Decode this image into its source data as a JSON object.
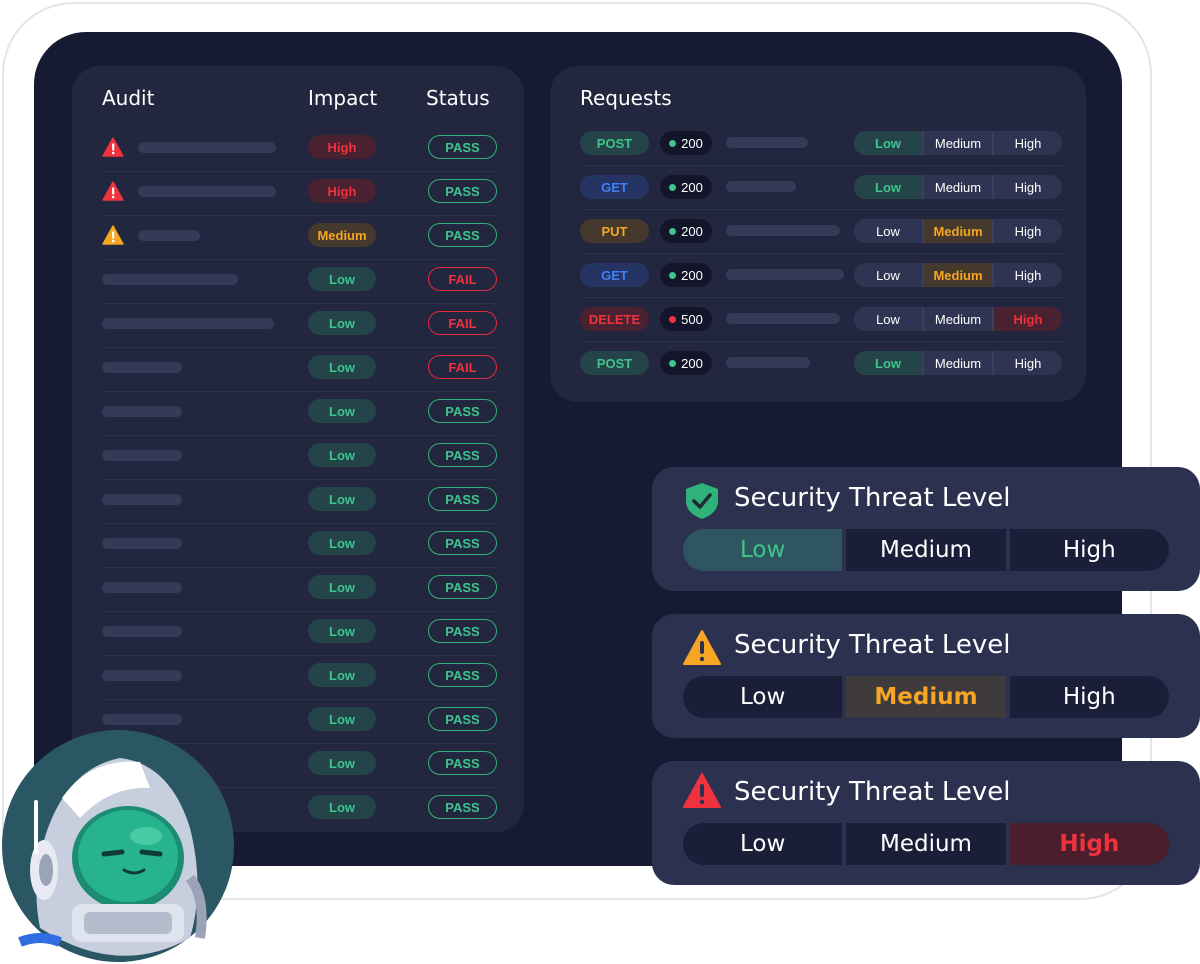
{
  "audit": {
    "header_audit": "Audit",
    "header_impact": "Impact",
    "header_status": "Status",
    "rows": [
      {
        "warn": "red",
        "bar": 138,
        "impact": "High",
        "status": "PASS"
      },
      {
        "warn": "red",
        "bar": 138,
        "impact": "High",
        "status": "PASS"
      },
      {
        "warn": "orange",
        "bar": 62,
        "impact": "Medium",
        "status": "PASS"
      },
      {
        "warn": "none",
        "bar": 136,
        "impact": "Low",
        "status": "FAIL"
      },
      {
        "warn": "none",
        "bar": 172,
        "impact": "Low",
        "status": "FAIL"
      },
      {
        "warn": "none",
        "bar": 80,
        "impact": "Low",
        "status": "FAIL"
      },
      {
        "warn": "none",
        "bar": 80,
        "impact": "Low",
        "status": "PASS"
      },
      {
        "warn": "none",
        "bar": 80,
        "impact": "Low",
        "status": "PASS"
      },
      {
        "warn": "none",
        "bar": 80,
        "impact": "Low",
        "status": "PASS"
      },
      {
        "warn": "none",
        "bar": 80,
        "impact": "Low",
        "status": "PASS"
      },
      {
        "warn": "none",
        "bar": 80,
        "impact": "Low",
        "status": "PASS"
      },
      {
        "warn": "none",
        "bar": 80,
        "impact": "Low",
        "status": "PASS"
      },
      {
        "warn": "none",
        "bar": 80,
        "impact": "Low",
        "status": "PASS"
      },
      {
        "warn": "none",
        "bar": 80,
        "impact": "Low",
        "status": "PASS"
      },
      {
        "warn": "none",
        "bar": 80,
        "impact": "Low",
        "status": "PASS"
      },
      {
        "warn": "none",
        "bar": 80,
        "impact": "Low",
        "status": "PASS"
      }
    ]
  },
  "requests": {
    "header": "Requests",
    "levels": [
      "Low",
      "Medium",
      "High"
    ],
    "rows": [
      {
        "method": "POST",
        "code": "200",
        "ok": true,
        "bar": 82,
        "level": "Low"
      },
      {
        "method": "GET",
        "code": "200",
        "ok": true,
        "bar": 70,
        "level": "Low"
      },
      {
        "method": "PUT",
        "code": "200",
        "ok": true,
        "bar": 114,
        "level": "Medium"
      },
      {
        "method": "GET",
        "code": "200",
        "ok": true,
        "bar": 118,
        "level": "Medium"
      },
      {
        "method": "DELETE",
        "code": "500",
        "ok": false,
        "bar": 114,
        "level": "High"
      },
      {
        "method": "POST",
        "code": "200",
        "ok": true,
        "bar": 84,
        "level": "Low"
      }
    ]
  },
  "threat_cards": [
    {
      "title": "Security Threat Level",
      "icon": "shield-check-icon",
      "active": "Low",
      "levels": [
        "Low",
        "Medium",
        "High"
      ]
    },
    {
      "title": "Security Threat Level",
      "icon": "warning-orange-icon",
      "active": "Medium",
      "levels": [
        "Low",
        "Medium",
        "High"
      ]
    },
    {
      "title": "Security Threat Level",
      "icon": "warning-red-icon",
      "active": "High",
      "levels": [
        "Low",
        "Medium",
        "High"
      ]
    }
  ],
  "colors": {
    "screen_bg": "#161a33",
    "panel_bg": "#22263f",
    "green": "#3fc48b",
    "red": "#f0323e",
    "orange": "#f6a623",
    "blue": "#3b82f6"
  },
  "mascot": "robot-helmet-mascot"
}
